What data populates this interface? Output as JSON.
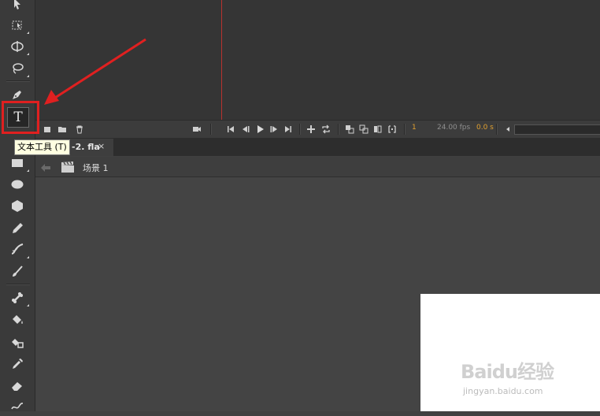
{
  "timeline": {
    "current_frame": "1",
    "fps": "24.00 fps",
    "time": "0.0 s"
  },
  "text_tool": {
    "glyph": "T"
  },
  "tooltip": {
    "text": "文本工具 (T)"
  },
  "document_tab": {
    "label": "-2. fla",
    "close": "×"
  },
  "scene": {
    "label": "场景 1"
  },
  "watermark": {
    "logo": "Baidu经验",
    "url": "jingyan.baidu.com"
  },
  "colors": {
    "highlight": "#e02020",
    "arrow": "#e02020",
    "playhead": "#b8322e",
    "frame_accent": "#e0a030"
  },
  "icons": [
    "selection-arrow-icon",
    "free-transform-icon",
    "3d-rotation-icon",
    "lasso-icon",
    "pen-icon",
    "text-icon",
    "rectangle-icon",
    "oval-icon",
    "polystar-icon",
    "pencil-icon",
    "paint-brush-icon",
    "brush-icon",
    "bone-icon",
    "paint-bucket-icon",
    "ink-bottle-icon",
    "eyedropper-icon",
    "eraser-icon",
    "width-tool-icon"
  ]
}
